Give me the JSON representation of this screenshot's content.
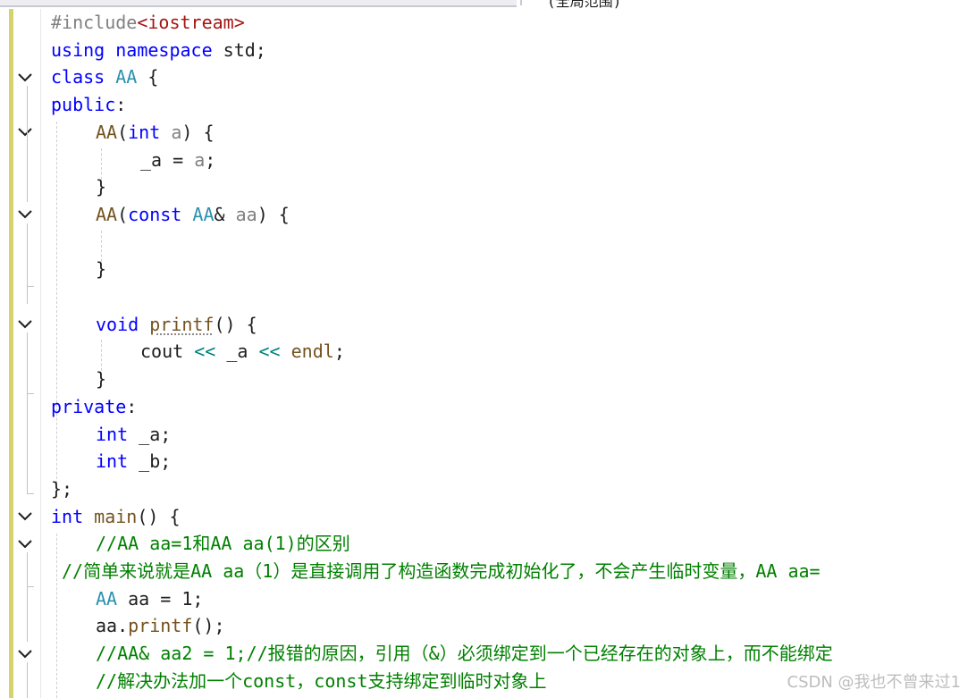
{
  "top_tab_partial": "(全局范围)",
  "code": {
    "l1": {
      "a": "#include",
      "b": "<iostream>"
    },
    "l2": {
      "a": "using",
      "b": "namespace",
      "c": " std;"
    },
    "l3": {
      "a": "class",
      "b": "AA",
      "c": " {"
    },
    "l4": {
      "a": "public",
      ":": ":"
    },
    "l5": {
      "a": "AA",
      "b": "(",
      "c": "int",
      "d": "a",
      "e": ") {"
    },
    "l6": {
      "a": "_a",
      "b": " = ",
      "c": "a",
      ";": ";"
    },
    "l7": {
      "a": "}"
    },
    "l8": {
      "a": "AA",
      "b": "(",
      "c": "const",
      "d": "AA",
      "e": "&",
      "f": "aa",
      "g": ") {"
    },
    "l9": {
      "a": "}"
    },
    "l10": {
      "a": "void",
      "b": "printf",
      "c": "() {"
    },
    "l11": {
      "a": "cout",
      "b": "<<",
      "c": "_a",
      "d": "<<",
      "e": "endl",
      "f": ";"
    },
    "l12": {
      "a": "}"
    },
    "l13": {
      "a": "private",
      ":": ":"
    },
    "l14": {
      "a": "int",
      "b": "_a;"
    },
    "l15": {
      "a": "int",
      "b": "_b;"
    },
    "l16": {
      "a": "};"
    },
    "l17": {
      "a": "int",
      "b": "main",
      "c": "() {"
    },
    "l18": {
      "a": "//AA aa=1和AA aa(1)的区别"
    },
    "l19": {
      "a": "//简单来说就是AA aa（1）是直接调用了构造函数完成初始化了，不会产生临时变量，AA aa="
    },
    "l20": {
      "a": "AA",
      "b": "aa",
      "c": " = 1;"
    },
    "l21": {
      "a": "aa",
      "b": ".",
      "c": "printf",
      "d": "();"
    },
    "l22": {
      "a": "//AA& aa2 = 1;//报错的原因，引用（&）必须绑定到一个已经存在的对象上，而不能绑定"
    },
    "l23": {
      "a": "//解决办法加一个const，const支持绑定到临时对象上"
    }
  },
  "watermark": "CSDN @我也不曾来过1"
}
